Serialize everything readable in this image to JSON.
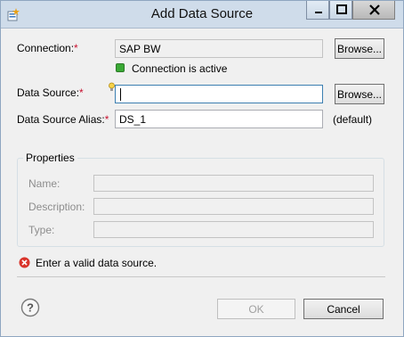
{
  "window": {
    "title": "Add Data Source",
    "app_icon": "app-wizard-icon",
    "controls": {
      "minimize": "minimize-icon",
      "maximize": "maximize-icon",
      "close": "close-icon"
    }
  },
  "form": {
    "connection": {
      "label": "Connection:",
      "required_mark": "*",
      "value": "SAP BW",
      "browse_label": "Browse..."
    },
    "connection_status": {
      "text": "Connection is active",
      "color": "#3aa935"
    },
    "data_source": {
      "label": "Data Source:",
      "required_mark": "*",
      "value": "",
      "hint_icon": "lightbulb-icon",
      "browse_label": "Browse..."
    },
    "alias": {
      "label": "Data Source Alias:",
      "required_mark": "*",
      "value": "DS_1",
      "suffix": "(default)"
    }
  },
  "properties": {
    "title": "Properties",
    "fields": [
      {
        "label": "Name:",
        "value": ""
      },
      {
        "label": "Description:",
        "value": ""
      },
      {
        "label": "Type:",
        "value": ""
      }
    ]
  },
  "message": {
    "icon": "error-icon",
    "text": "Enter a valid data source.",
    "color": "#d9342b"
  },
  "footer": {
    "help_icon": "help-icon",
    "ok_label": "OK",
    "cancel_label": "Cancel"
  }
}
